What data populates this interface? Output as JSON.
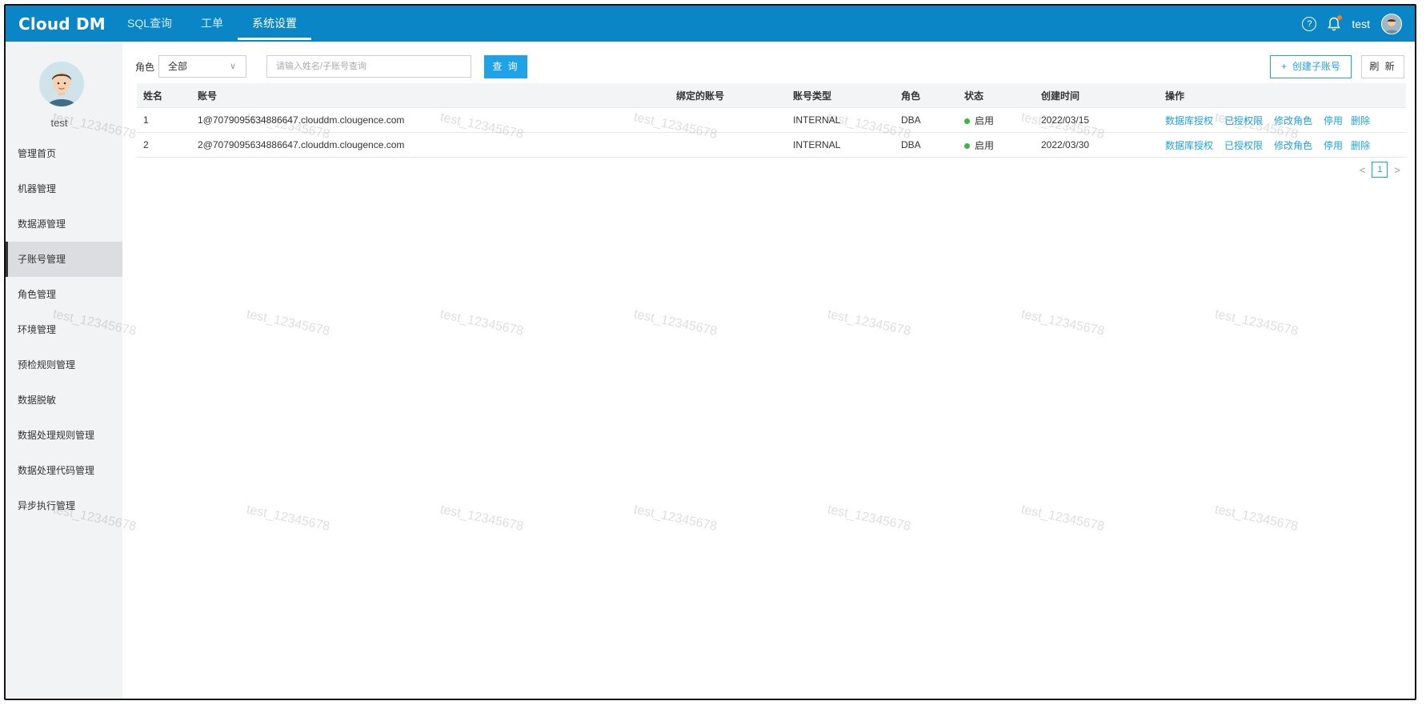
{
  "app": {
    "logo": "Cloud DM"
  },
  "top_nav": [
    {
      "label": "SQL查询",
      "active": false
    },
    {
      "label": "工单",
      "active": false
    },
    {
      "label": "系统设置",
      "active": true
    }
  ],
  "header_right": {
    "help_icon": "question-circle-icon",
    "bell_icon": "bell-icon",
    "username": "test"
  },
  "sidebar": {
    "profile_name": "test",
    "items": [
      {
        "label": "管理首页"
      },
      {
        "label": "机器管理"
      },
      {
        "label": "数据源管理"
      },
      {
        "label": "子账号管理",
        "active": true
      },
      {
        "label": "角色管理"
      },
      {
        "label": "环境管理"
      },
      {
        "label": "预检规则管理"
      },
      {
        "label": "数据脱敏"
      },
      {
        "label": "数据处理规则管理"
      },
      {
        "label": "数据处理代码管理"
      },
      {
        "label": "异步执行管理"
      }
    ]
  },
  "filter": {
    "role_label": "角色",
    "role_value": "全部",
    "search_placeholder": "请输入姓名/子账号查询",
    "query_button": "查 询"
  },
  "actions": {
    "create_button": "创建子账号",
    "refresh_button": "刷 新"
  },
  "table": {
    "headers": [
      "姓名",
      "账号",
      "绑定的账号",
      "账号类型",
      "角色",
      "状态",
      "创建时间",
      "操作"
    ],
    "rows": [
      {
        "name": "1",
        "account": "1@7079095634886647.clouddm.clougence.com",
        "bound": "",
        "type": "INTERNAL",
        "role": "DBA",
        "status": "启用",
        "created": "2022/03/15"
      },
      {
        "name": "2",
        "account": "2@7079095634886647.clouddm.clougence.com",
        "bound": "",
        "type": "INTERNAL",
        "role": "DBA",
        "status": "启用",
        "created": "2022/03/30"
      }
    ],
    "operations": [
      "数据库授权",
      "已授权限",
      "修改角色",
      "停用",
      "删除"
    ]
  },
  "pagination": {
    "current_page": "1",
    "prev": "<",
    "next": ">"
  },
  "watermark": "test_12345678",
  "colors": {
    "topbar": "#0a86c7",
    "accent": "#1ea2e8",
    "status_ok": "#3bb54a",
    "sidebar_bg": "#f2f3f5"
  }
}
